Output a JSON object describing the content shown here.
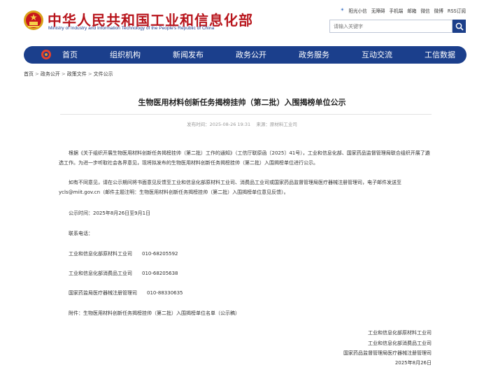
{
  "header": {
    "title": "中华人民共和国工业和信息化部",
    "subtitle": "Ministry of Industry and Information Technology of the People's Republic of China",
    "top_links": [
      "阳光小信",
      "无障碍",
      "手机端",
      "邮箱",
      "微信",
      "微博",
      "RSS订阅"
    ],
    "search_placeholder": "请输入关键字"
  },
  "nav": {
    "items": [
      "首页",
      "组织机构",
      "新闻发布",
      "政务公开",
      "政务服务",
      "互动交流",
      "工信数据"
    ]
  },
  "breadcrumb": [
    "首页",
    "政务公开",
    "政策文件",
    "文件公示"
  ],
  "article": {
    "title": "生物医用材料创新任务揭榜挂帅（第二批）入围揭榜单位公示",
    "publish_label": "发布时间：",
    "publish_time": "2025-08-26 19:31",
    "source_label": "来源：",
    "source": "原材料工业司",
    "para1": "根据《关于组织开展生物医用材料创新任务揭榜挂帅（第二批）工作的通知》（工信厅联原函〔2025〕41号），工业和信息化部、国家药品监督管理局联合组织开展了遴选工作。为进一步听取社会各界意见，现将拟发布的生物医用材料创新任务揭榜挂帅（第二批）入围揭榜单位进行公示。",
    "para2": "如有不同意见，请在公示期间将书面意见反馈至工业和信息化部原材料工业司、消费品工业司或国家药品监督管理局医疗器械注册管理司，电子邮件发送至ycls@miit.gov.cn（邮件主题注明：生物医用材料创新任务揭榜挂帅（第二批）入围揭榜单位意见反馈）。",
    "period": "公示时间：2025年8月26日至9月1日",
    "contact_label": "联系电话：",
    "contacts": [
      {
        "dept": "工业和信息化部原材料工业司",
        "phone": "010-68205592"
      },
      {
        "dept": "工业和信息化部消费品工业司",
        "phone": "010-68205638"
      },
      {
        "dept": "国家药监局医疗器械注册管理司",
        "phone": "010-88330635"
      }
    ],
    "attachment": "附件：生物医用材料创新任务揭榜挂帅（第二批）入围揭榜单位名单（公示稿）",
    "signatures": [
      "工业和信息化部原材料工业司",
      "工业和信息化部消费品工业司",
      "国家药品监督管理局医疗器械注册管理司"
    ],
    "date": "2025年8月26日"
  }
}
